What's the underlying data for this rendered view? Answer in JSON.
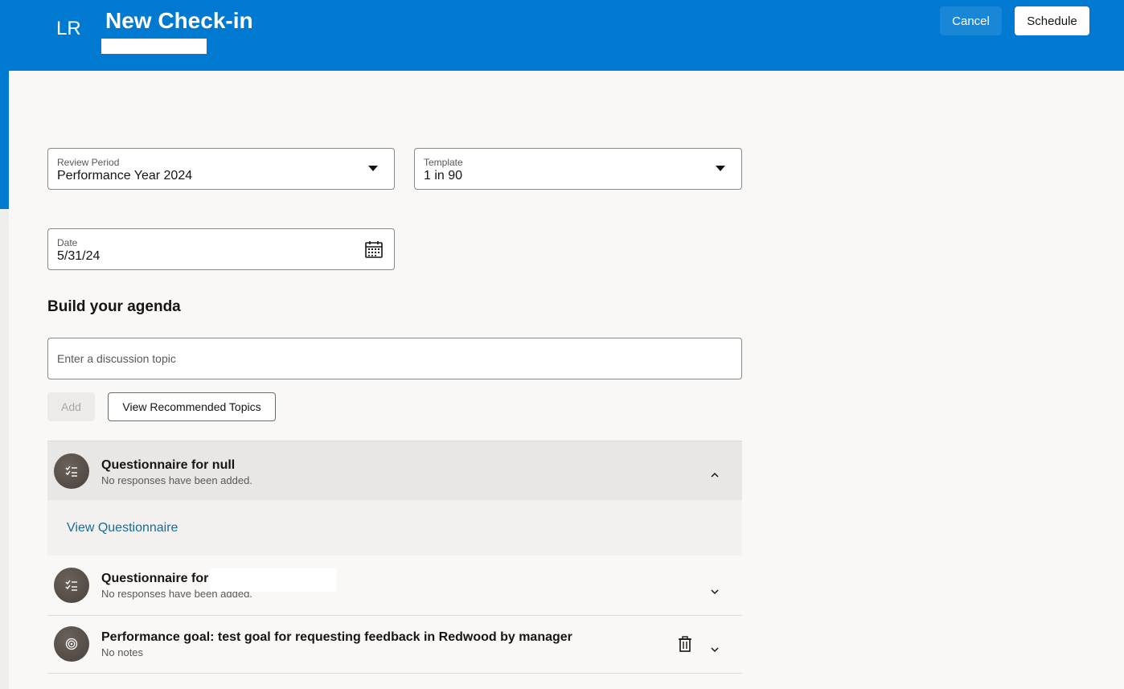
{
  "header": {
    "initials": "LR",
    "title": "New Check-in",
    "cancel_label": "Cancel",
    "schedule_label": "Schedule"
  },
  "form": {
    "review_period": {
      "label": "Review Period",
      "value": "Performance Year 2024"
    },
    "template": {
      "label": "Template",
      "value": "1 in 90"
    },
    "date": {
      "label": "Date",
      "value": "5/31/24"
    }
  },
  "agenda": {
    "title": "Build your agenda",
    "topic_placeholder": "Enter a discussion topic",
    "add_label": "Add",
    "recommended_label": "View Recommended Topics",
    "items": [
      {
        "title": "Questionnaire for null",
        "subtitle": "No responses have been added.",
        "expanded": true,
        "link_label": "View Questionnaire",
        "icon": "checklist-icon"
      },
      {
        "title": "Questionnaire for",
        "subtitle": "No responses have been added.",
        "expanded": false,
        "icon": "checklist-icon"
      },
      {
        "title": "Performance goal: test goal for requesting feedback in Redwood by manager",
        "subtitle": "No notes",
        "expanded": false,
        "icon": "target-icon"
      }
    ]
  },
  "colors": {
    "header_blue": "#0079d1",
    "page_bg": "#f9f8f6",
    "expanded_header_bg": "#e8e7e5",
    "expanded_body_bg": "#f2f1ef",
    "link": "#1b6a96"
  }
}
